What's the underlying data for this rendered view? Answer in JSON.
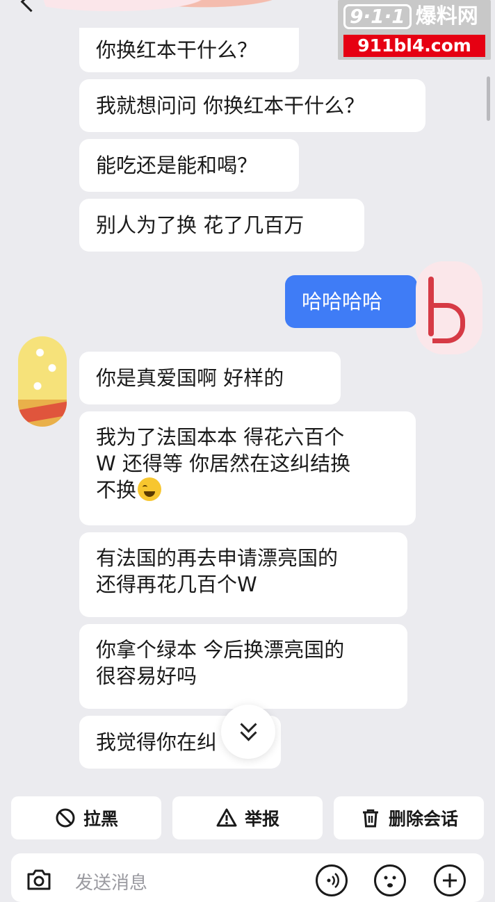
{
  "watermark": {
    "logo": "9·1·1",
    "site_name": "爆料网",
    "url": "911bl4.com"
  },
  "messages": [
    {
      "dir": "in",
      "text": "你换红本干什么？"
    },
    {
      "dir": "in",
      "text": "我就想问问 你换红本干什么？"
    },
    {
      "dir": "in",
      "text": "能吃还是能和喝？"
    },
    {
      "dir": "in",
      "text": "别人为了换 花了几百万"
    },
    {
      "dir": "out",
      "text": "哈哈哈哈"
    },
    {
      "dir": "in",
      "text": "你是真爱国啊 好样的"
    },
    {
      "dir": "in",
      "lines": [
        "我为了法国本本 得花六百个",
        "W 还得等 你居然在这纠结换",
        "不换"
      ],
      "emoji": "crying-laughing"
    },
    {
      "dir": "in",
      "lines": [
        "有法国的再去申请漂亮国的",
        "还得再花几百个W"
      ]
    },
    {
      "dir": "in",
      "lines": [
        "你拿个绿本 今后换漂亮国的",
        "很容易好吗"
      ]
    },
    {
      "dir": "in",
      "text": "我觉得你在纠"
    }
  ],
  "actions": {
    "block": "拉黑",
    "report": "举报",
    "delete": "删除会话"
  },
  "input": {
    "placeholder": "发送消息"
  },
  "icons": [
    "back-icon",
    "more-icon",
    "chevron-double-down-icon",
    "block-icon",
    "warning-icon",
    "trash-icon",
    "camera-icon",
    "voice-icon",
    "emoji-icon",
    "plus-icon"
  ]
}
